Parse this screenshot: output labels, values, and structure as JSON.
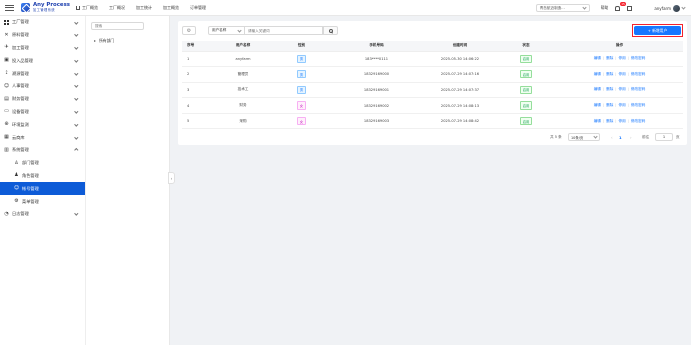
{
  "header": {
    "logo_title": "Any Process",
    "logo_subtitle": "加工管理系统",
    "nav": [
      "工厂概览",
      "工厂概况",
      "加工统计",
      "加工概览",
      "订单管理"
    ],
    "factory_select": "青岛航迈制造...",
    "help": "帮助",
    "notification_count": "15",
    "username": "anyfarm"
  },
  "sidebar": {
    "items": [
      {
        "label": "工厂管理",
        "icon": "grid-icon",
        "chevron": true
      },
      {
        "label": "原料管理",
        "icon": "tools-icon",
        "chevron": true
      },
      {
        "label": "加工管理",
        "icon": "plane-icon",
        "chevron": true
      },
      {
        "label": "投入品管理",
        "icon": "person-card-icon",
        "chevron": true
      },
      {
        "label": "溯源管理",
        "icon": "trace-icon",
        "chevron": true
      },
      {
        "label": "人事管理",
        "icon": "user-icon",
        "chevron": true
      },
      {
        "label": "财务管理",
        "icon": "finance-icon",
        "chevron": true
      },
      {
        "label": "设备管理",
        "icon": "monitor-icon",
        "chevron": true
      },
      {
        "label": "环境监测",
        "icon": "globe-icon",
        "chevron": true
      },
      {
        "label": "云商库",
        "icon": "cloud-shop-icon",
        "chevron": true
      },
      {
        "label": "系统管理",
        "icon": "system-icon",
        "chevron": true,
        "open": true
      },
      {
        "label": "部门管理",
        "icon": "person-icon",
        "sub": true
      },
      {
        "label": "角色管理",
        "icon": "role-icon",
        "sub": true
      },
      {
        "label": "帐号管理",
        "icon": "account-icon",
        "sub": true,
        "active": true
      },
      {
        "label": "菜单管理",
        "icon": "gear-icon",
        "sub": true
      },
      {
        "label": "日志管理",
        "icon": "log-icon",
        "chevron": true
      }
    ]
  },
  "tree": {
    "search_placeholder": "搜索",
    "root": "所有部门"
  },
  "toolbar": {
    "field_select": "用户名称",
    "keyword_placeholder": "请输入关键词",
    "add_button": "+ 新增用户"
  },
  "table": {
    "headers": [
      "序号",
      "用户名称",
      "性别",
      "手机号码",
      "创建时间",
      "状态",
      "操作"
    ],
    "rows": [
      {
        "idx": "1",
        "name": "anyfarm",
        "gender": "男",
        "gender_type": "m",
        "phone": "183****0111",
        "created": "2025-05-30 14:06:22",
        "status": "启用"
      },
      {
        "idx": "2",
        "name": "管理员",
        "gender": "男",
        "gender_type": "m",
        "phone": "18329169000",
        "created": "2025-07-29 14:07:16",
        "status": "启用"
      },
      {
        "idx": "3",
        "name": "技术工",
        "gender": "男",
        "gender_type": "m",
        "phone": "18329169001",
        "created": "2025-07-29 14:07:37",
        "status": "启用"
      },
      {
        "idx": "4",
        "name": "财务",
        "gender": "女",
        "gender_type": "f",
        "phone": "18329169002",
        "created": "2025-07-29 14:08:13",
        "status": "启用"
      },
      {
        "idx": "5",
        "name": "采购",
        "gender": "女",
        "gender_type": "f",
        "phone": "18329169003",
        "created": "2025-07-29 14:08:42",
        "status": "启用"
      }
    ],
    "ops": [
      "编辑",
      "删除",
      "停用",
      "修改密码"
    ]
  },
  "pager": {
    "total": "共 5 条",
    "page_size": "10条/页",
    "current_page": "1",
    "goto_label": "前往",
    "goto_value": "1",
    "page_unit": "页"
  },
  "colors": {
    "primary": "#1677ff",
    "active_menu": "#0d5bd7",
    "highlight_outline": "#f5222d"
  }
}
